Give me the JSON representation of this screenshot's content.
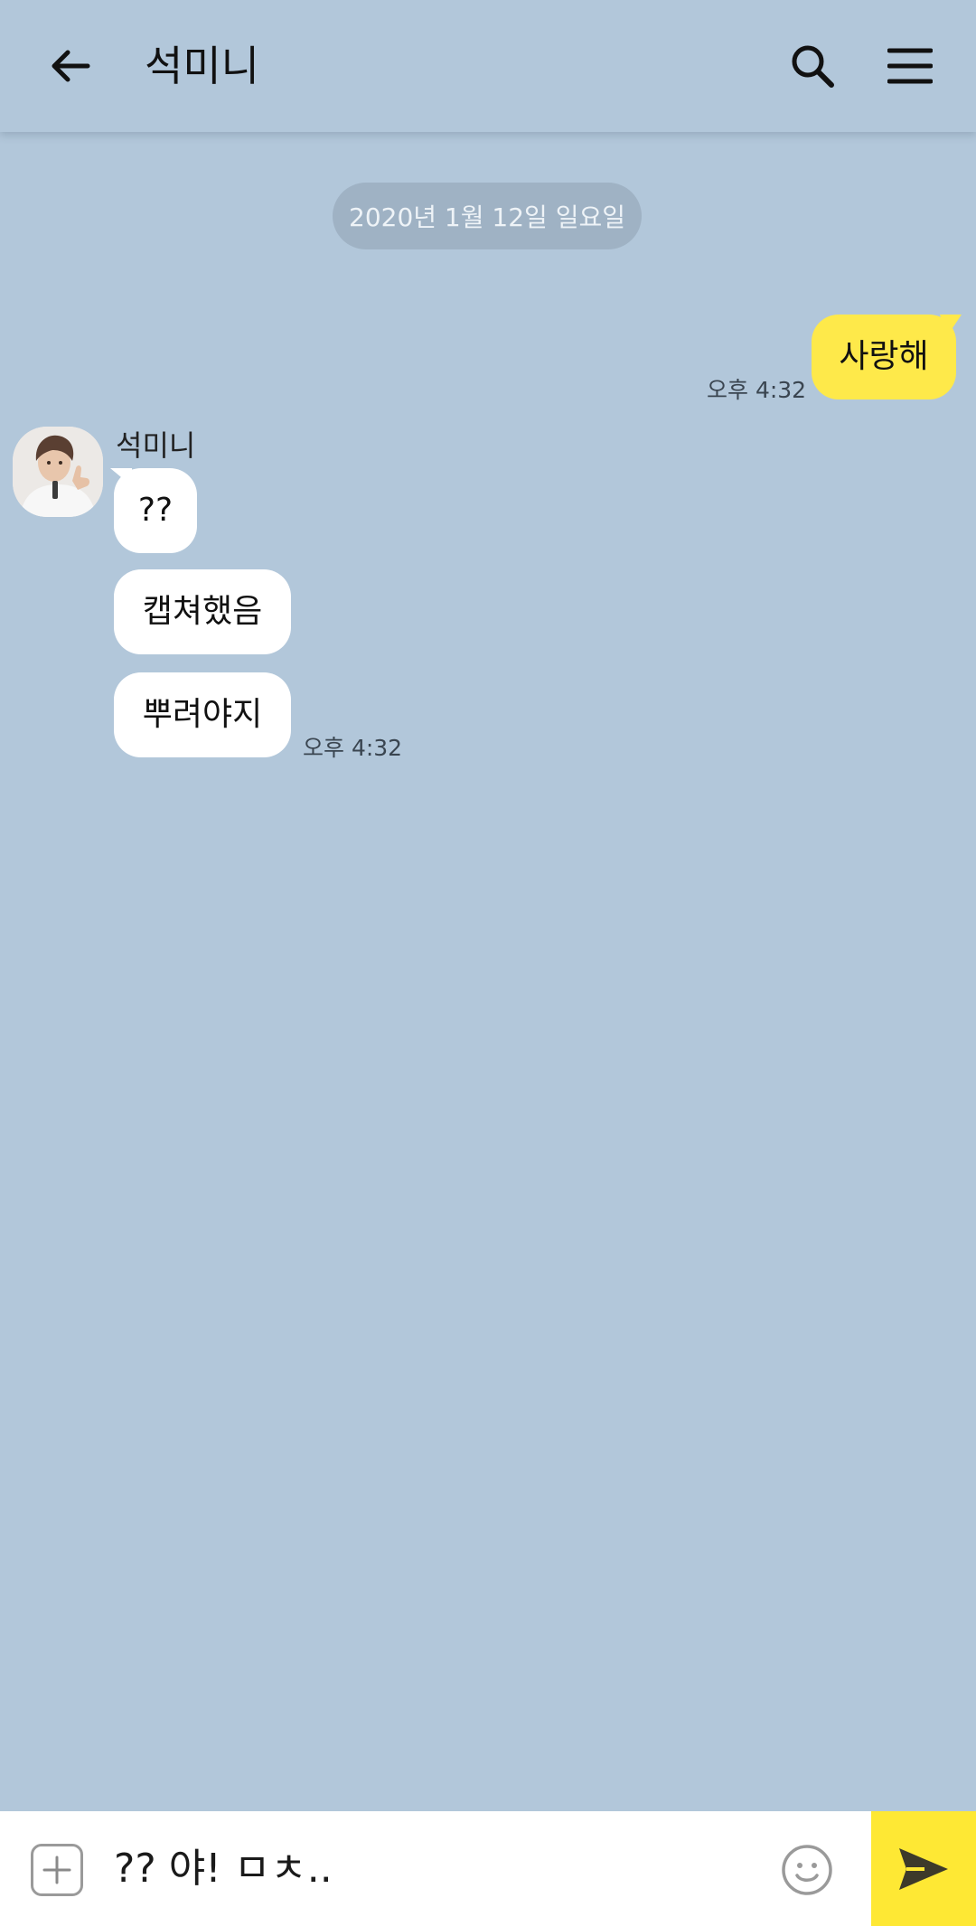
{
  "header": {
    "title": "석미니",
    "back_icon": "arrow-left-icon",
    "search_icon": "search-icon",
    "menu_icon": "hamburger-menu-icon"
  },
  "chat": {
    "date_divider": "2020년 1월 12일 일요일",
    "my_messages": [
      {
        "text": "사랑해",
        "time": "오후 4:32"
      }
    ],
    "other": {
      "sender": "석미니",
      "messages": [
        {
          "text": "??"
        },
        {
          "text": "캡쳐했음"
        },
        {
          "text": "뿌려야지"
        }
      ],
      "time": "오후 4:32"
    }
  },
  "composer": {
    "value": "?? 야! ㅁㅊ..",
    "plus_icon": "plus-icon",
    "emoji_icon": "emoji-icon",
    "send_icon": "send-icon"
  },
  "colors": {
    "background": "#b2c7da",
    "my_bubble": "#fee94a",
    "other_bubble": "#ffffff",
    "send_button": "#fee834"
  }
}
